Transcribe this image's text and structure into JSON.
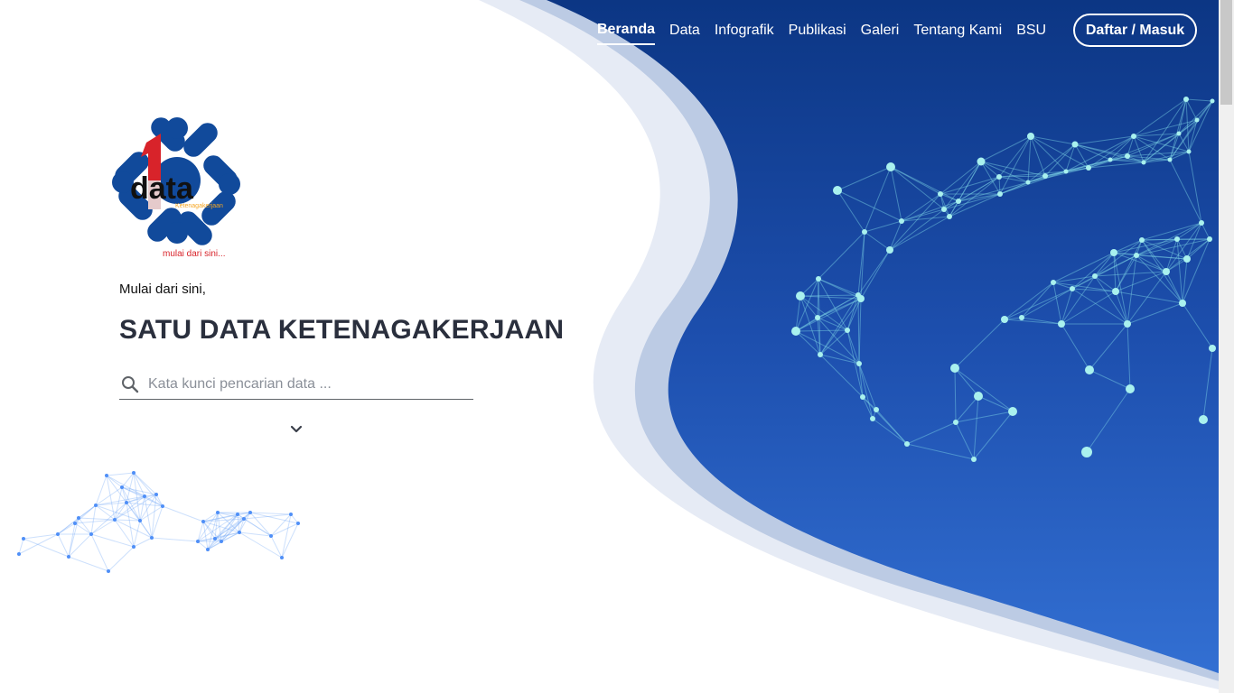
{
  "nav": {
    "items": [
      {
        "label": "Beranda"
      },
      {
        "label": "Data"
      },
      {
        "label": "Infografik"
      },
      {
        "label": "Publikasi"
      },
      {
        "label": "Galeri"
      },
      {
        "label": "Tentang Kami"
      },
      {
        "label": "BSU"
      }
    ],
    "login_label": "Daftar / Masuk"
  },
  "logo": {
    "text": "data",
    "subtitle": "Ketenagakerjaan",
    "slogan": "mulai dari sini..."
  },
  "hero": {
    "tagline": "Mulai dari sini,",
    "title": "SATU DATA KETENAGAKERJAAN"
  },
  "search": {
    "placeholder": "Kata kunci pencarian data ..."
  },
  "icons": {
    "search": "search-icon",
    "scroll": "chevron-down-icon"
  },
  "colors": {
    "brand_blue": "#0d3a88",
    "accent_blue": "#2f6cd0",
    "node_cyan": "#a9f1ee",
    "logo_red": "#d8232a"
  }
}
